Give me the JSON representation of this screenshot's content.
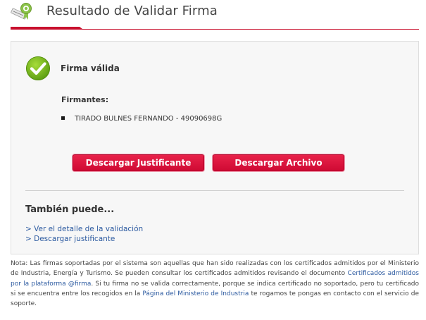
{
  "header": {
    "title": "Resultado de Validar Firma",
    "icon": "certificate-ribbon-icon"
  },
  "status": {
    "icon": "check-circle-icon",
    "text": "Firma válida"
  },
  "signers": {
    "label": "Firmantes:",
    "items": [
      "TIRADO BULNES FERNANDO - 49090698G"
    ]
  },
  "buttons": {
    "download_justificante": "Descargar Justificante",
    "download_archivo": "Descargar Archivo"
  },
  "also": {
    "title": "También puede...",
    "links": [
      "> Ver el detalle de la validación",
      "> Descargar justificante"
    ]
  },
  "note": {
    "part1": "Nota: Las firmas soportadas por el sistema son aquellas que han sido realizadas con los certificados admitidos por el Ministerio de Industria, Energía y Turismo. Se pueden consultar los certificados admitidos revisando el documento ",
    "link1": "Certificados admitidos por la plataforma @firma",
    "part2": ". Si tu firma no se valida correctamente, porque se indica certificado no soportado, pero tu certificado si se encuentra entre los recogidos en la ",
    "link2": "Página del Ministerio de Industria",
    "part3": " te rogamos te pongas en contacto con el servicio de soporte."
  },
  "colors": {
    "accent": "#c8102e",
    "button": "#e0163f",
    "success": "#7cbf1c",
    "link": "#2c5aa0"
  }
}
